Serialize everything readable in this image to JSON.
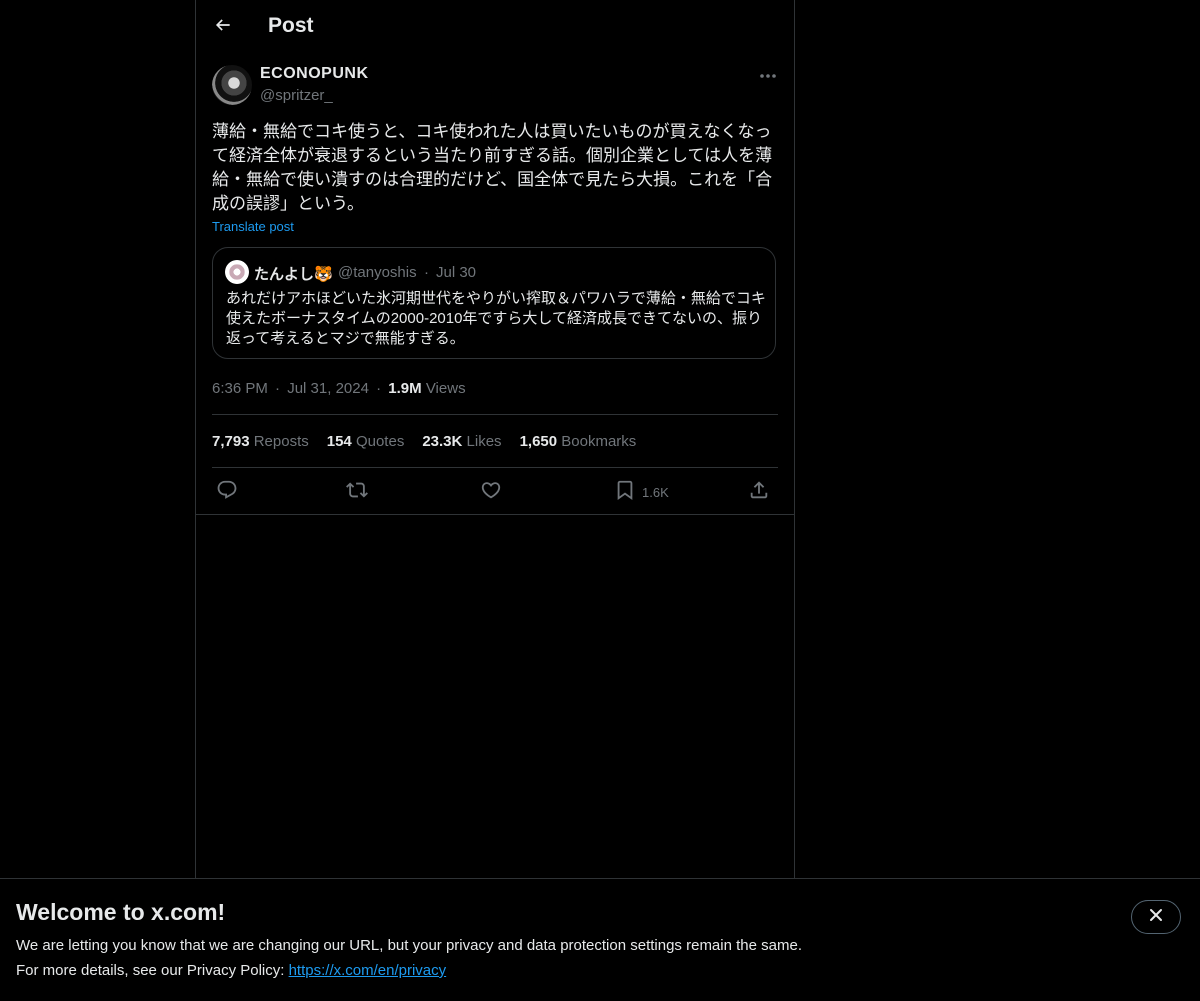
{
  "header": {
    "title": "Post",
    "back_icon": "arrow-left-icon"
  },
  "post": {
    "author_name": "ECONOPUNK",
    "author_handle": "@spritzer_",
    "text": "薄給・無給でコキ使うと、コキ使われた人は買いたいものが買えなくなって経済全体が衰退するという当たり前すぎる話。個別企業としては人を薄給・無給で使い潰すのは合理的だけど、国全体で見たら大損。これを「合成の誤謬」という。",
    "translate_label": "Translate post",
    "time": "6:36 PM",
    "date": "Jul 31, 2024",
    "separator": "·",
    "views_count": "1.9M",
    "views_label": "Views",
    "quote": {
      "author_name": "たんよし",
      "author_emoji": "🐯",
      "author_handle": "@tanyoshis",
      "separator": "·",
      "date": "Jul 30",
      "text": "あれだけアホほどいた氷河期世代をやりがい搾取＆パワハラで薄給・無給でコキ使えたボーナスタイムの2000-2010年ですら大して経済成長できてないの、振り返って考えるとマジで無能すぎる。"
    },
    "stats": {
      "reposts_count": "7,793",
      "reposts_label": "Reposts",
      "quotes_count": "154",
      "quotes_label": "Quotes",
      "likes_count": "23.3K",
      "likes_label": "Likes",
      "bookmarks_count": "1,650",
      "bookmarks_label": "Bookmarks"
    },
    "actions": {
      "reply_icon": "reply-icon",
      "repost_icon": "repost-icon",
      "like_icon": "heart-icon",
      "bookmark_icon": "bookmark-icon",
      "bookmark_count": "1.6K",
      "share_icon": "share-icon"
    }
  },
  "banner": {
    "title": "Welcome to x.com!",
    "line1": "We are letting you know that we are changing our URL, but your privacy and data protection settings remain the same.",
    "line2_prefix": "For more details, see our Privacy Policy: ",
    "link": "https://x.com/en/privacy",
    "close_icon": "close-icon"
  },
  "colors": {
    "background": "#000000",
    "text": "#e7e9ea",
    "secondary_text": "#71767b",
    "accent": "#1d9bf0",
    "border": "#2f3336"
  }
}
